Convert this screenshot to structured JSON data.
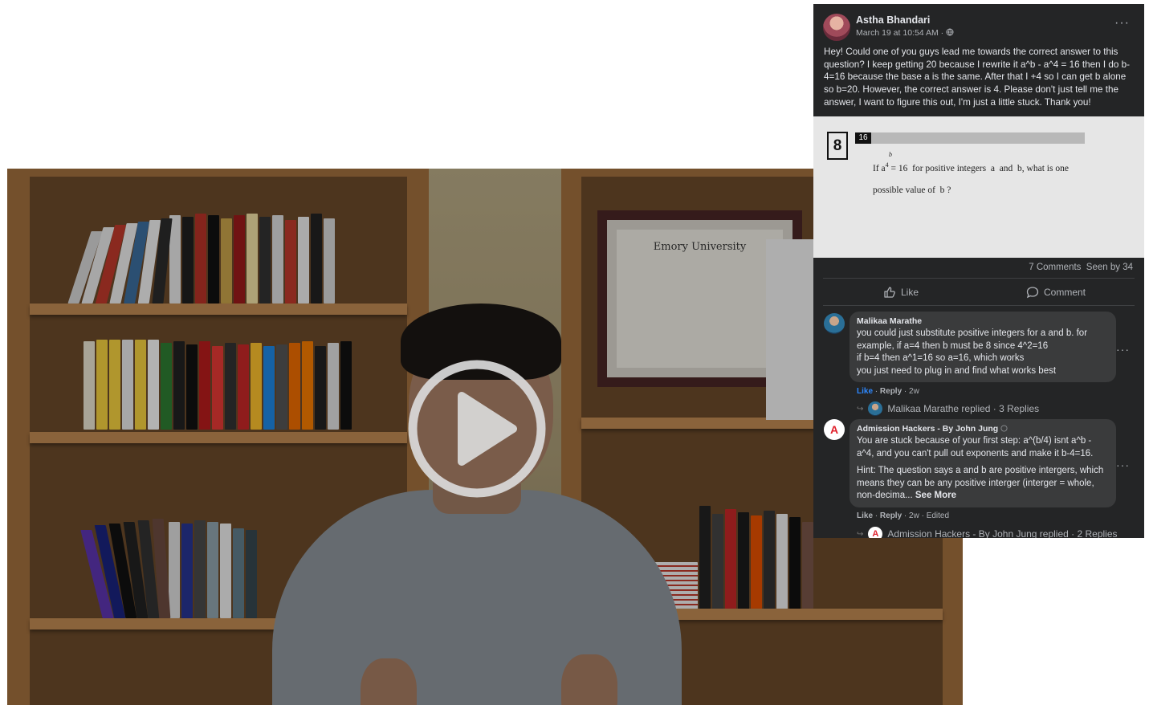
{
  "video": {
    "play_icon": "play-icon",
    "diploma_title": "Emory University",
    "play_color": "#d9d9d9"
  },
  "post": {
    "author": "Astha Bhandari",
    "timestamp": "March 19 at 10:54 AM · ",
    "audience_icon": "globe-icon",
    "more_icon": "···",
    "text": "Hey! Could one of you guys lead me towards the correct answer to this question? I keep getting 20 because I rewrite it a^b - a^4 = 16 then I do b-4=16 because the base a is the same. After that I +4 so I can get b alone so b=20. However, the correct answer is 4. Please don't just tell me the answer, I want to figure this out, I'm just a little stuck. Thank you!",
    "image": {
      "question_box": "8",
      "bar_number": "16",
      "exponent": "b",
      "line1": "If a",
      "line1_exp": "4",
      "line1_rest": " = 16  for positive integers  a  and  b, what is one",
      "line2": "possible value of  b ?"
    },
    "stats": "7 Comments  Seen by 34",
    "like_label": "Like",
    "comment_label": "Comment"
  },
  "comments": [
    {
      "name": "Malikaa Marathe",
      "lines": [
        "you could just substitute positive integers for a and b. for example, if a=4 then b must be 8 since 4^2=16",
        "if b=4 then a^1=16 so a=16, which works",
        "you just need to plug in and find what works best"
      ],
      "like": "Like",
      "reply": "Reply",
      "age": "2w",
      "replies": "Malikaa Marathe replied · 3 Replies"
    },
    {
      "name": "Admission Hackers - By John Jung",
      "avatar_letter": "A",
      "para1": "You are stuck because of your first step: a^(b/4) isnt a^b - a^4, and you can't pull out exponents and make it b-4=16.",
      "para2": "Hint: The question says a and b are positive intergers, which means they can be any positive interger (interger = whole, non-decima...",
      "see_more": "See More",
      "like": "Like",
      "reply": "Reply",
      "age": "2w · Edited",
      "replies": "Admission Hackers - By John Jung replied · 2 Replies"
    }
  ]
}
